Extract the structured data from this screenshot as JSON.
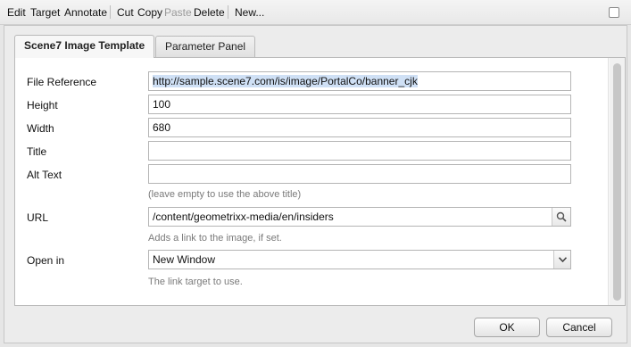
{
  "toolbar": {
    "items": [
      "Edit",
      "Target",
      "Annotate",
      "Cut",
      "Copy",
      "Paste",
      "Delete",
      "New..."
    ]
  },
  "tabs": [
    {
      "label": "Scene7 Image Template",
      "active": true
    },
    {
      "label": "Parameter Panel",
      "active": false
    }
  ],
  "form": {
    "file_reference": {
      "label": "File Reference",
      "value": "http://sample.scene7.com/is/image/PortalCo/banner_cjk"
    },
    "height": {
      "label": "Height",
      "value": "100"
    },
    "width": {
      "label": "Width",
      "value": "680"
    },
    "title": {
      "label": "Title",
      "value": ""
    },
    "alt_text": {
      "label": "Alt Text",
      "value": "",
      "hint": "(leave empty to use the above title)"
    },
    "url": {
      "label": "URL",
      "value": "/content/geometrixx-media/en/insiders",
      "hint": "Adds a link to the image, if set."
    },
    "open_in": {
      "label": "Open in",
      "value": "New Window",
      "hint": "The link target to use."
    }
  },
  "buttons": {
    "ok": "OK",
    "cancel": "Cancel"
  },
  "icons": {
    "search": "search-icon",
    "dropdown": "chevron-down-icon",
    "checkbox": "checkbox-icon"
  }
}
